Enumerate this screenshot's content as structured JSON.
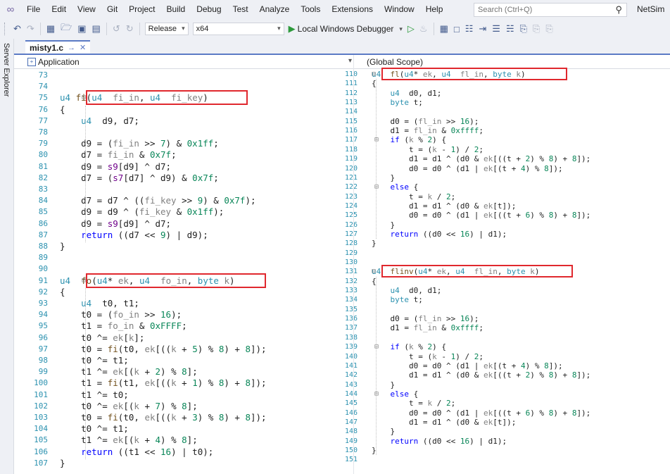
{
  "menu": [
    "File",
    "Edit",
    "View",
    "Git",
    "Project",
    "Build",
    "Debug",
    "Test",
    "Analyze",
    "Tools",
    "Extensions",
    "Window",
    "Help"
  ],
  "search": {
    "placeholder": "Search (Ctrl+Q)"
  },
  "solution_name": "NetSim",
  "toolbar": {
    "config": "Release",
    "platform": "x64",
    "debugger": "Local Windows Debugger"
  },
  "side_panel": "Server Explorer",
  "tab": {
    "name": "misty1.c",
    "pin": "→",
    "close": "✕"
  },
  "nav": {
    "left": "Application",
    "right": "(Global Scope)"
  },
  "left_code": [
    {
      "n": "73",
      "t": ""
    },
    {
      "n": "74",
      "t": ""
    },
    {
      "n": "75",
      "t": "u4 fi(u4  fi_in, u4  fi_key)"
    },
    {
      "n": "76",
      "t": "{"
    },
    {
      "n": "77",
      "t": "    u4  d9, d7;"
    },
    {
      "n": "78",
      "t": ""
    },
    {
      "n": "79",
      "t": "    d9 = (fi_in >> 7) & 0x1ff;"
    },
    {
      "n": "80",
      "t": "    d7 = fi_in & 0x7f;"
    },
    {
      "n": "81",
      "t": "    d9 = s9[d9] ^ d7;"
    },
    {
      "n": "82",
      "t": "    d7 = (s7[d7] ^ d9) & 0x7f;"
    },
    {
      "n": "83",
      "t": ""
    },
    {
      "n": "84",
      "t": "    d7 = d7 ^ ((fi_key >> 9) & 0x7f);"
    },
    {
      "n": "85",
      "t": "    d9 = d9 ^ (fi_key & 0x1ff);"
    },
    {
      "n": "86",
      "t": "    d9 = s9[d9] ^ d7;"
    },
    {
      "n": "87",
      "t": "    return ((d7 << 9) | d9);"
    },
    {
      "n": "88",
      "t": "}"
    },
    {
      "n": "89",
      "t": ""
    },
    {
      "n": "90",
      "t": ""
    },
    {
      "n": "91",
      "t": "u4  fo(u4* ek, u4  fo_in, byte k)"
    },
    {
      "n": "92",
      "t": "{"
    },
    {
      "n": "93",
      "t": "    u4  t0, t1;"
    },
    {
      "n": "94",
      "t": "    t0 = (fo_in >> 16);"
    },
    {
      "n": "95",
      "t": "    t1 = fo_in & 0xFFFF;"
    },
    {
      "n": "96",
      "t": "    t0 ^= ek[k];"
    },
    {
      "n": "97",
      "t": "    t0 = fi(t0, ek[((k + 5) % 8) + 8]);"
    },
    {
      "n": "98",
      "t": "    t0 ^= t1;"
    },
    {
      "n": "99",
      "t": "    t1 ^= ek[(k + 2) % 8];"
    },
    {
      "n": "100",
      "t": "    t1 = fi(t1, ek[((k + 1) % 8) + 8]);"
    },
    {
      "n": "101",
      "t": "    t1 ^= t0;"
    },
    {
      "n": "102",
      "t": "    t0 ^= ek[(k + 7) % 8];"
    },
    {
      "n": "103",
      "t": "    t0 = fi(t0, ek[((k + 3) % 8) + 8]);"
    },
    {
      "n": "104",
      "t": "    t0 ^= t1;"
    },
    {
      "n": "105",
      "t": "    t1 ^= ek[(k + 4) % 8];"
    },
    {
      "n": "106",
      "t": "    return ((t1 << 16) | t0);"
    },
    {
      "n": "107",
      "t": "}"
    }
  ],
  "right_code": [
    {
      "n": "110",
      "t": "u4  fl(u4* ek, u4  fl_in, byte k)"
    },
    {
      "n": "111",
      "t": "{"
    },
    {
      "n": "112",
      "t": "    u4  d0, d1;"
    },
    {
      "n": "113",
      "t": "    byte t;"
    },
    {
      "n": "114",
      "t": ""
    },
    {
      "n": "115",
      "t": "    d0 = (fl_in >> 16);"
    },
    {
      "n": "116",
      "t": "    d1 = fl_in & 0xffff;"
    },
    {
      "n": "117",
      "t": "    if (k % 2) {"
    },
    {
      "n": "118",
      "t": "        t = (k - 1) / 2;"
    },
    {
      "n": "119",
      "t": "        d1 = d1 ^ (d0 & ek[((t + 2) % 8) + 8]);"
    },
    {
      "n": "120",
      "t": "        d0 = d0 ^ (d1 | ek[(t + 4) % 8]);"
    },
    {
      "n": "121",
      "t": "    }"
    },
    {
      "n": "122",
      "t": "    else {"
    },
    {
      "n": "123",
      "t": "        t = k / 2;"
    },
    {
      "n": "124",
      "t": "        d1 = d1 ^ (d0 & ek[t]);"
    },
    {
      "n": "125",
      "t": "        d0 = d0 ^ (d1 | ek[((t + 6) % 8) + 8]);"
    },
    {
      "n": "126",
      "t": "    }"
    },
    {
      "n": "127",
      "t": "    return ((d0 << 16) | d1);"
    },
    {
      "n": "128",
      "t": "}"
    },
    {
      "n": "129",
      "t": ""
    },
    {
      "n": "130",
      "t": ""
    },
    {
      "n": "131",
      "t": "u4  flinv(u4* ek, u4  fl_in, byte k)"
    },
    {
      "n": "132",
      "t": "{"
    },
    {
      "n": "133",
      "t": "    u4  d0, d1;"
    },
    {
      "n": "134",
      "t": "    byte t;"
    },
    {
      "n": "135",
      "t": ""
    },
    {
      "n": "136",
      "t": "    d0 = (fl_in >> 16);"
    },
    {
      "n": "137",
      "t": "    d1 = fl_in & 0xffff;"
    },
    {
      "n": "138",
      "t": ""
    },
    {
      "n": "139",
      "t": "    if (k % 2) {"
    },
    {
      "n": "140",
      "t": "        t = (k - 1) / 2;"
    },
    {
      "n": "141",
      "t": "        d0 = d0 ^ (d1 | ek[(t + 4) % 8]);"
    },
    {
      "n": "142",
      "t": "        d1 = d1 ^ (d0 & ek[((t + 2) % 8) + 8]);"
    },
    {
      "n": "143",
      "t": "    }"
    },
    {
      "n": "144",
      "t": "    else {"
    },
    {
      "n": "145",
      "t": "        t = k / 2;"
    },
    {
      "n": "146",
      "t": "        d0 = d0 ^ (d1 | ek[((t + 6) % 8) + 8]);"
    },
    {
      "n": "147",
      "t": "        d1 = d1 ^ (d0 & ek[t]);"
    },
    {
      "n": "148",
      "t": "    }"
    },
    {
      "n": "149",
      "t": "    return ((d0 << 16) | d1);"
    },
    {
      "n": "150",
      "t": "}"
    },
    {
      "n": "151",
      "t": ""
    }
  ],
  "colors": {
    "keyword": "#0000ff",
    "type": "#2b91af",
    "number": "#098658",
    "function": "#74531f",
    "param": "#808080",
    "macro": "#6f008a",
    "highlight": "#e0282e",
    "accent": "#5b7ac5"
  }
}
